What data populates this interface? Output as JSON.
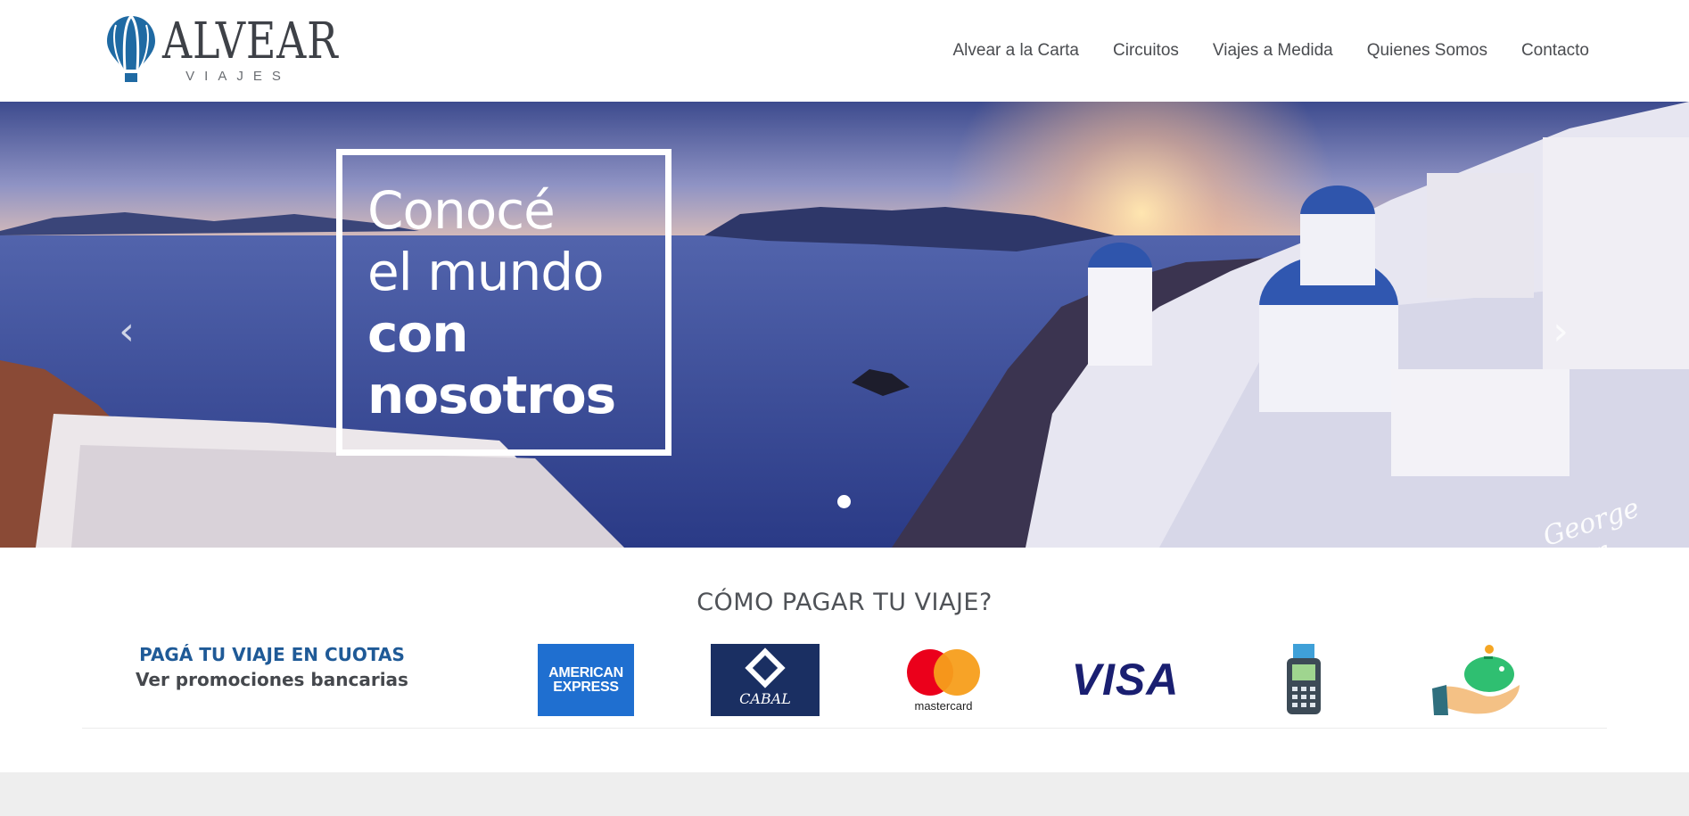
{
  "brand": {
    "name": "ALVEAR",
    "tagline": "VIAJES"
  },
  "nav": {
    "items": [
      "Alvear a la Carta",
      "Circuitos",
      "Viajes a Medida",
      "Quienes Somos",
      "Contacto"
    ]
  },
  "hero": {
    "line1": "Conocé",
    "line2": "el mundo",
    "line3": "con",
    "line4": "nosotros",
    "prev_icon": "chevron-left-icon",
    "next_icon": "chevron-right-icon",
    "signature": "George Mer"
  },
  "payment": {
    "title": "CÓMO PAGAR TU VIAJE?",
    "cuotas": "PAGÁ TU VIAJE EN CUOTAS",
    "promo": "Ver promociones bancarias",
    "amex_line1": "AMERICAN",
    "amex_line2": "EXPRESS",
    "cabal": "CABAL",
    "mastercard": "mastercard",
    "visa": "VISA"
  },
  "colors": {
    "accent_blue": "#1f5a97",
    "text_gray": "#4a4c50",
    "footer_gray": "#eeeeee"
  }
}
